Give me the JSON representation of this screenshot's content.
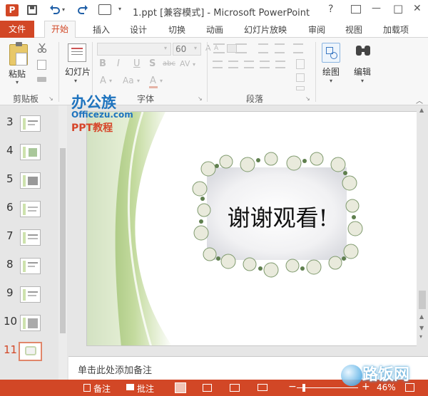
{
  "titlebar": {
    "title": "1.ppt [兼容模式] - Microsoft PowerPoint",
    "app_icon_letter": "P",
    "quick_label": "1",
    "controls": [
      "?",
      "—",
      "□",
      "✕"
    ]
  },
  "tabs": [
    "文件",
    "开始",
    "插入",
    "设计",
    "切换",
    "动画",
    "幻灯片放映",
    "审阅",
    "视图",
    "加载项"
  ],
  "ribbon": {
    "paste": "粘贴",
    "slides": "幻灯片",
    "font_size": "60",
    "font_size_placeholder": "60",
    "font_buttons": [
      "B",
      "I",
      "U",
      "S",
      "abc",
      "AV"
    ],
    "font_buttons2": [
      "A",
      "Aa",
      "A",
      "A"
    ],
    "drawing": "绘图",
    "editing": "编辑",
    "groups": [
      "剪贴板",
      "字体",
      "段落"
    ]
  },
  "watermark": {
    "logo_text": "办公族",
    "site": "Officezu.com",
    "tutorial": "PPT教程"
  },
  "slides_panel": {
    "numbers": [
      "3",
      "4",
      "5",
      "6",
      "7",
      "8",
      "9",
      "10",
      "11"
    ],
    "selected": "11"
  },
  "slide": {
    "text": "谢谢观看!"
  },
  "notes": {
    "placeholder": "单击此处添加备注"
  },
  "status": {
    "notes": "备注",
    "comments": "批注",
    "zoom": "46%",
    "zoom_fraction": 0.46,
    "watermark_brand": "路饭网"
  },
  "colors": {
    "accent": "#d24726",
    "ribbon_bg": "#f7f7f7",
    "pane_bg": "#e6e6e6"
  }
}
